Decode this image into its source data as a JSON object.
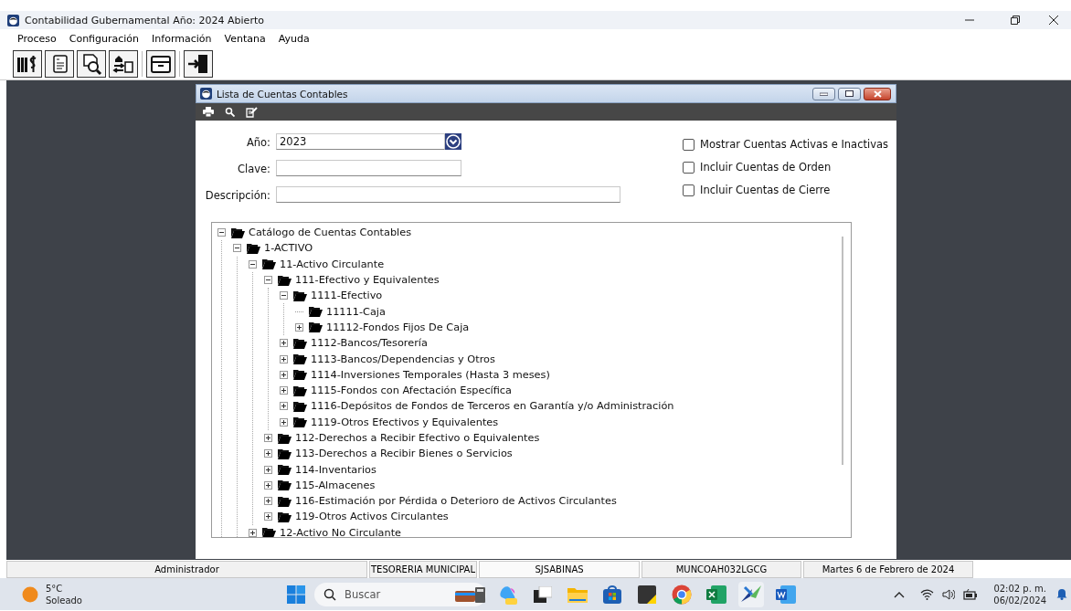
{
  "window": {
    "title": "Contabilidad Gubernamental Año: 2024 Abierto"
  },
  "menu": [
    "Proceso",
    "Configuración",
    "Información",
    "Ventana",
    "Ayuda"
  ],
  "dialog": {
    "title": "Lista de Cuentas Contables",
    "fields": [
      {
        "label": "Año:",
        "value": "2023",
        "kind": "dropdown"
      },
      {
        "label": "Clave:",
        "kind": "text"
      },
      {
        "label": "Descripción:",
        "kind": "text"
      }
    ],
    "checkboxes": [
      {
        "label": "Mostrar Cuentas Activas e Inactivas",
        "checked": false
      },
      {
        "label": "Incluir Cuentas de Orden",
        "checked": false
      },
      {
        "label": "Incluir Cuentas de Cierre",
        "checked": false
      }
    ],
    "tree": [
      {
        "label": "Catálogo de Cuentas Contables",
        "kind": "branch",
        "expanded": true,
        "children": [
          {
            "label": "1-ACTIVO",
            "kind": "branch",
            "expanded": true,
            "children": [
              {
                "label": "11-Activo Circulante",
                "kind": "branch",
                "expanded": true,
                "children": [
                  {
                    "label": "111-Efectivo y Equivalentes",
                    "kind": "branch",
                    "expanded": true,
                    "children": [
                      {
                        "label": "1111-Efectivo",
                        "kind": "branch",
                        "expanded": true,
                        "children": [
                          {
                            "label": "11111-Caja",
                            "kind": "leaf"
                          },
                          {
                            "label": "11112-Fondos Fijos De Caja",
                            "kind": "branch",
                            "expanded": false
                          }
                        ]
                      },
                      {
                        "label": "1112-Bancos/Tesorería",
                        "kind": "branch",
                        "expanded": false
                      },
                      {
                        "label": "1113-Bancos/Dependencias y Otros",
                        "kind": "branch",
                        "expanded": false
                      },
                      {
                        "label": "1114-Inversiones Temporales (Hasta 3 meses)",
                        "kind": "branch",
                        "expanded": false
                      },
                      {
                        "label": "1115-Fondos con Afectación Específica",
                        "kind": "branch",
                        "expanded": false
                      },
                      {
                        "label": "1116-Depósitos de Fondos de Terceros en Garantía y/o Administración",
                        "kind": "branch",
                        "expanded": false
                      },
                      {
                        "label": "1119-Otros Efectivos y Equivalentes",
                        "kind": "branch",
                        "expanded": false
                      }
                    ]
                  },
                  {
                    "label": "112-Derechos a Recibir Efectivo o Equivalentes",
                    "kind": "branch",
                    "expanded": false
                  },
                  {
                    "label": "113-Derechos a Recibir Bienes o Servicios",
                    "kind": "branch",
                    "expanded": false
                  },
                  {
                    "label": "114-Inventarios",
                    "kind": "branch",
                    "expanded": false
                  },
                  {
                    "label": "115-Almacenes",
                    "kind": "branch",
                    "expanded": false
                  },
                  {
                    "label": "116-Estimación por Pérdida o Deterioro de Activos Circulantes",
                    "kind": "branch",
                    "expanded": false
                  },
                  {
                    "label": "119-Otros Activos Circulantes",
                    "kind": "branch",
                    "expanded": false
                  }
                ]
              },
              {
                "label": "12-Activo No Circulante",
                "kind": "branch",
                "expanded": false
              }
            ]
          }
        ]
      }
    ]
  },
  "status_bar": [
    "Administrador",
    "TESORERIA MUNICIPAL",
    "SJSABINAS",
    "MUNCOAH032LGCG",
    "Martes 6 de Febrero de 2024"
  ],
  "taskbar": {
    "weather": {
      "temperature": "5°C",
      "condition": "Soleado"
    },
    "search": {
      "placeholder": "Buscar"
    },
    "time": "02:02 p. m.",
    "date": "06/02/2024"
  }
}
